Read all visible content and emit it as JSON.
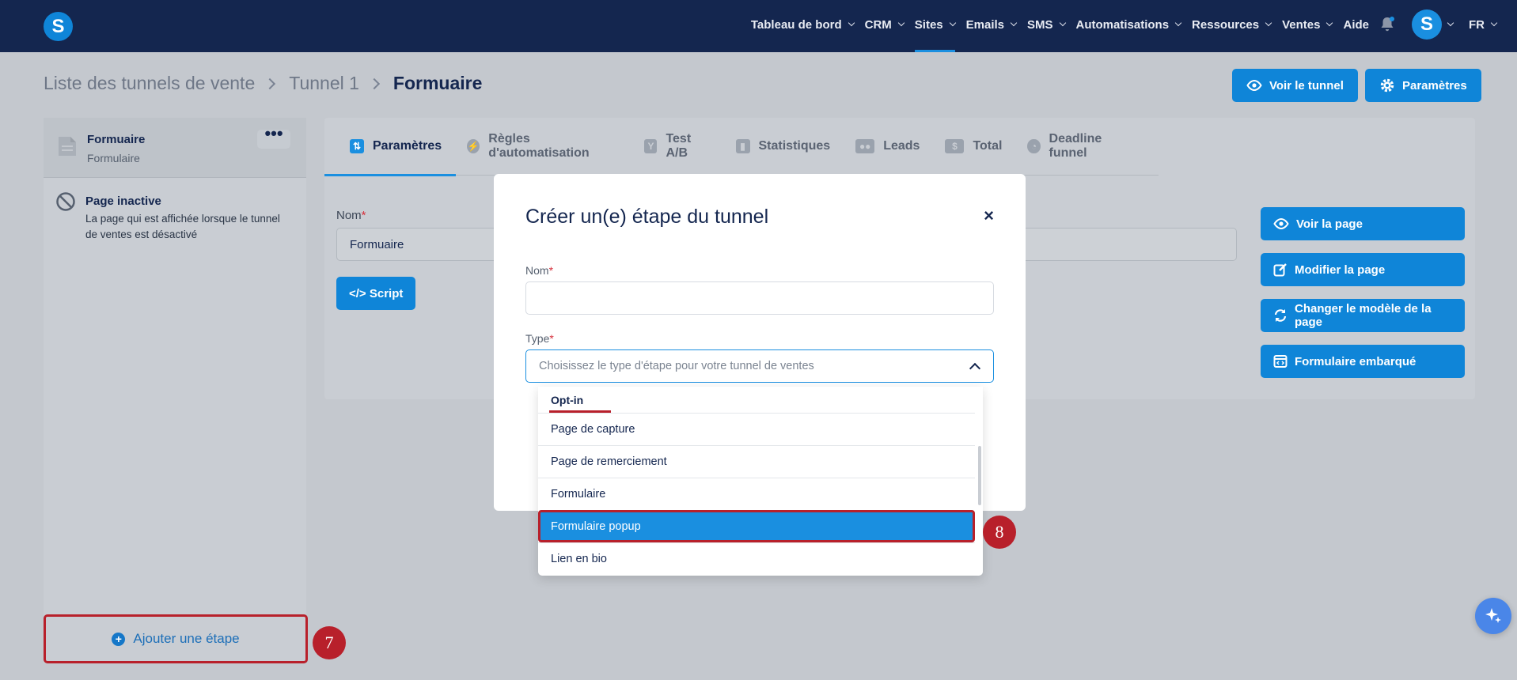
{
  "nav": {
    "logo": "S",
    "items": [
      {
        "label": "Tableau de bord"
      },
      {
        "label": "CRM"
      },
      {
        "label": "Sites"
      },
      {
        "label": "Emails"
      },
      {
        "label": "SMS"
      },
      {
        "label": "Automatisations"
      },
      {
        "label": "Ressources"
      },
      {
        "label": "Ventes"
      },
      {
        "label": "Aide"
      }
    ],
    "active_item": "Sites",
    "avatar": "S",
    "language": "FR"
  },
  "breadcrumb": [
    "Liste des tunnels de vente",
    "Tunnel 1",
    "Formuaire"
  ],
  "header_buttons": {
    "view_funnel": "Voir le tunnel",
    "settings": "Paramètres"
  },
  "sidebar": {
    "active_step": {
      "title": "Formuaire",
      "subtitle": "Formulaire",
      "more": "•••"
    },
    "inactive_page": {
      "title": "Page inactive",
      "description": "La page qui est affichée lorsque le tunnel de ventes est désactivé"
    },
    "add_step": "Ajouter une étape"
  },
  "tabs": [
    {
      "label": "Paramètres",
      "icon": "sliders-icon"
    },
    {
      "label": "Règles d'automatisation",
      "icon": "bolt-icon"
    },
    {
      "label": "Test A/B",
      "icon": "split-icon"
    },
    {
      "label": "Statistiques",
      "icon": "bar-chart-icon"
    },
    {
      "label": "Leads",
      "icon": "users-icon"
    },
    {
      "label": "Total",
      "icon": "dollar-icon"
    },
    {
      "label": "Deadline funnel",
      "icon": "clock-icon"
    }
  ],
  "form": {
    "name_label": "Nom",
    "name_value": "Formuaire",
    "script_button": "</> Script"
  },
  "side_buttons": {
    "view_page": "Voir la page",
    "edit_page": "Modifier la page",
    "change_template": "Changer le modèle de la page",
    "embedded_form": "Formulaire embarqué"
  },
  "modal": {
    "title": "Créer un(e) étape du tunnel",
    "close": "×",
    "name_label": "Nom",
    "type_label": "Type",
    "type_placeholder": "Choisissez le type d'étape pour votre tunnel de ventes"
  },
  "dropdown": {
    "group": "Opt-in",
    "options": [
      "Page de capture",
      "Page de remerciement",
      "Formulaire",
      "Formulaire popup",
      "Lien en bio"
    ],
    "selected": "Formulaire popup"
  },
  "annotations": {
    "step7": "7",
    "step8": "8"
  },
  "colors": {
    "navy": "#14264f",
    "accent": "#1a8fe0",
    "highlight": "#b8202b"
  }
}
